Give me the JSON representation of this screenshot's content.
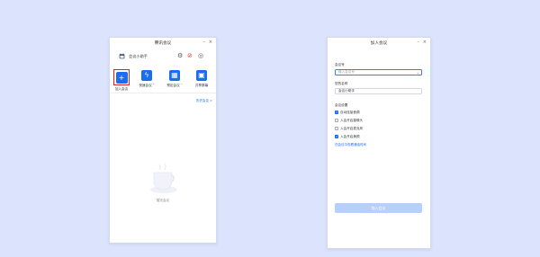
{
  "left_window": {
    "title": "腾讯会议",
    "minimize": "–",
    "close": "×",
    "user_name": "会议小助手",
    "actions": [
      {
        "label": "加入会议",
        "glyph": "+"
      },
      {
        "label": "快速会议 ˅",
        "glyph": "ϟ"
      },
      {
        "label": "预定会议 ˅",
        "glyph": "▦"
      },
      {
        "label": "共享屏幕",
        "glyph": "▣"
      }
    ],
    "history_link": "历史会议 >",
    "empty_text": "暂无会议",
    "icons": [
      "calendar-icon",
      "settings-icon",
      "new-meeting-icon",
      "avatar-icon"
    ],
    "accent": "#1a6cf0",
    "highlight": "#e02020"
  },
  "right_window": {
    "title": "加入会议",
    "minimize": "–",
    "close": "×",
    "meeting_id_label": "会议号",
    "meeting_id_placeholder": "输入会议号",
    "name_label": "您的名称",
    "name_value": "会议小助手",
    "settings_label": "会议设置",
    "options": [
      {
        "label": "自动连接音频",
        "checked": true
      },
      {
        "label": "入会开启摄像头",
        "checked": false
      },
      {
        "label": "入会开启麦克风",
        "checked": false
      },
      {
        "label": "入会开启美颜",
        "checked": true
      }
    ],
    "more_link": "在会议中查看通话时间",
    "join_button": "加入会议"
  }
}
